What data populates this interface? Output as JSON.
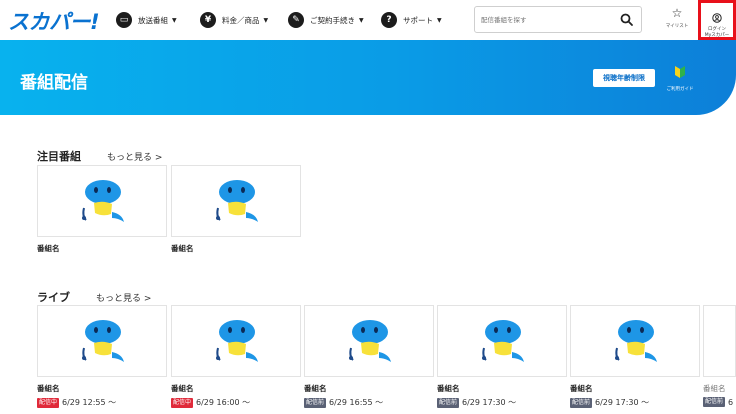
{
  "header": {
    "logo": "スカパー!",
    "nav": [
      {
        "label": "放送番組",
        "icon": "tv-icon"
      },
      {
        "label": "料金／商品",
        "icon": "yen-icon"
      },
      {
        "label": "ご契約手続き",
        "icon": "pen-icon"
      },
      {
        "label": "サポート",
        "icon": "help-icon"
      }
    ],
    "search": {
      "placeholder": "配信番組を探す"
    },
    "mylist_label": "マイリスト",
    "login_label_1": "ログイン",
    "login_label_2": "Myスカパー"
  },
  "banner": {
    "title": "番組配信",
    "age_limit_button": "視聴年齢制限",
    "guide_label": "ご利用ガイド"
  },
  "featured": {
    "title": "注目番組",
    "more": "もっと見る >",
    "items": [
      {
        "name": "番組名"
      },
      {
        "name": "番組名"
      }
    ]
  },
  "live": {
    "title": "ライブ",
    "more": "もっと見る >",
    "items": [
      {
        "name": "番組名",
        "status": "配信中",
        "time": "6/29 12:55 〜"
      },
      {
        "name": "番組名",
        "status": "配信中",
        "time": "6/29 16:00 〜"
      },
      {
        "name": "番組名",
        "status": "配信前",
        "time": "6/29 16:55 〜"
      },
      {
        "name": "番組名",
        "status": "配信前",
        "time": "6/29 17:30 〜"
      },
      {
        "name": "番組名",
        "status": "配信前",
        "time": "6/29 17:30 〜"
      },
      {
        "name": "番組名",
        "status": "配信前",
        "time": "6"
      }
    ]
  },
  "colors": {
    "brand": "#0a72d0",
    "banner_start": "#08b2ee",
    "banner_end": "#0d7fd8",
    "live_badge": "#e02a3a",
    "pre_badge": "#5a6175",
    "login_highlight": "#e8101a"
  }
}
